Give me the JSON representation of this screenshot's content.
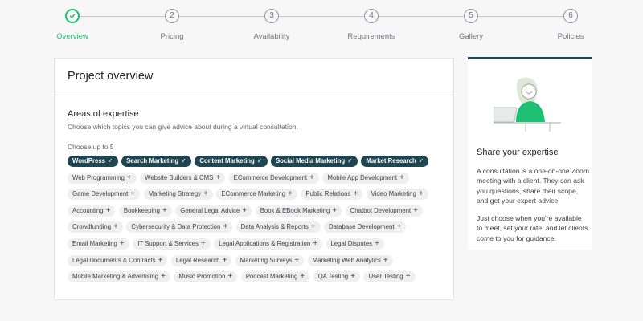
{
  "stepper": {
    "steps": [
      {
        "number": "",
        "label": "Overview",
        "status": "done"
      },
      {
        "number": "2",
        "label": "Pricing"
      },
      {
        "number": "3",
        "label": "Availability"
      },
      {
        "number": "4",
        "label": "Requirements"
      },
      {
        "number": "5",
        "label": "Gallery"
      },
      {
        "number": "6",
        "label": "Policies"
      }
    ]
  },
  "main": {
    "title": "Project overview",
    "section": {
      "title": "Areas of expertise",
      "description": "Choose which topics you can give advice about during a virtual consultation.",
      "hint": "Choose up to 5",
      "selected_icon": "✓",
      "add_icon": "+",
      "tags": [
        {
          "label": "WordPress",
          "selected": true
        },
        {
          "label": "Search Marketing",
          "selected": true
        },
        {
          "label": "Content Marketing",
          "selected": true
        },
        {
          "label": "Social Media Marketing",
          "selected": true
        },
        {
          "label": "Market Research",
          "selected": true
        },
        {
          "label": "Web Programming",
          "selected": false
        },
        {
          "label": "Website Builders & CMS",
          "selected": false
        },
        {
          "label": "ECommerce Development",
          "selected": false
        },
        {
          "label": "Mobile App Development",
          "selected": false
        },
        {
          "label": "Game Development",
          "selected": false
        },
        {
          "label": "Marketing Strategy",
          "selected": false
        },
        {
          "label": "ECommerce Marketing",
          "selected": false
        },
        {
          "label": "Public Relations",
          "selected": false
        },
        {
          "label": "Video Marketing",
          "selected": false
        },
        {
          "label": "Accounting",
          "selected": false
        },
        {
          "label": "Bookkeeping",
          "selected": false
        },
        {
          "label": "General Legal Advice",
          "selected": false
        },
        {
          "label": "Book & EBook Marketing",
          "selected": false
        },
        {
          "label": "Chatbot Development",
          "selected": false
        },
        {
          "label": "Crowdfunding",
          "selected": false
        },
        {
          "label": "Cybersecurity & Data Protection",
          "selected": false
        },
        {
          "label": "Data Analysis & Reports",
          "selected": false
        },
        {
          "label": "Database Development",
          "selected": false
        },
        {
          "label": "Email Marketing",
          "selected": false
        },
        {
          "label": "IT Support & Services",
          "selected": false
        },
        {
          "label": "Legal Applications & Registration",
          "selected": false
        },
        {
          "label": "Legal Disputes",
          "selected": false
        },
        {
          "label": "Legal Documents & Contracts",
          "selected": false
        },
        {
          "label": "Legal Research",
          "selected": false
        },
        {
          "label": "Marketing Surveys",
          "selected": false
        },
        {
          "label": "Marketing Web Analytics",
          "selected": false
        },
        {
          "label": "Mobile Marketing & Advertising",
          "selected": false
        },
        {
          "label": "Music Promotion",
          "selected": false
        },
        {
          "label": "Podcast Marketing",
          "selected": false
        },
        {
          "label": "QA Testing",
          "selected": false
        },
        {
          "label": "User Testing",
          "selected": false
        }
      ]
    }
  },
  "side": {
    "illustration_icon": "person-at-laptop-illustration",
    "title": "Share your expertise",
    "paragraph1": "A consultation is a one-on-one Zoom meeting with a client. They can ask you questions, share their scope, and get your expert advice.",
    "paragraph2": "Just choose when you're available to meet, set your rate, and let clients come to you for guidance."
  },
  "colors": {
    "accent_green": "#1dbf73",
    "selected_tag": "#1f4650",
    "tag_background": "#efeff0"
  }
}
